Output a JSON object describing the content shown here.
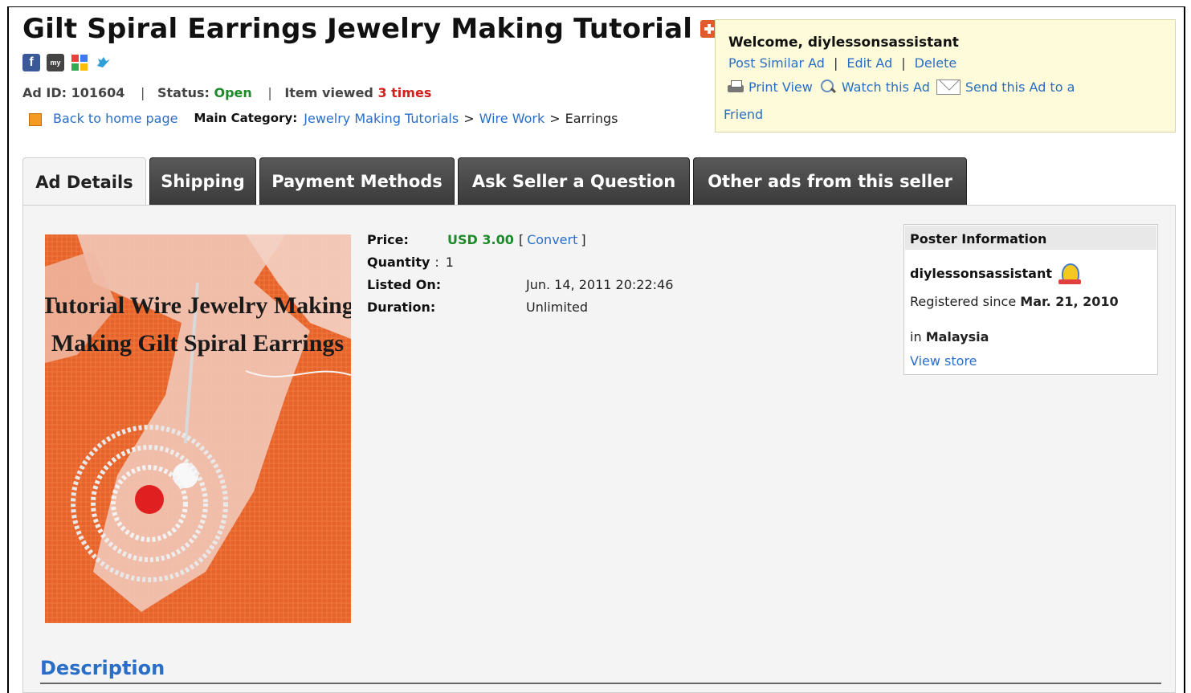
{
  "ad": {
    "title": "Gilt Spiral Earrings Jewelry Making Tutorial",
    "id_label": "Ad ID:",
    "id_value": "101604",
    "status_label": "Status:",
    "status_value": "Open",
    "views_label": "Item viewed",
    "views_value": "3 times"
  },
  "social": {
    "facebook": "f",
    "myspace": "my",
    "google": "g",
    "twitter": "t"
  },
  "nav": {
    "back_home": "Back to home page",
    "main_category_label": "Main Category:",
    "cat1": "Jewelry Making Tutorials",
    "cat2": "Wire Work",
    "cat3": "Earrings"
  },
  "account": {
    "welcome": "Welcome, diylessonsassistant",
    "post_similar": "Post Similar Ad",
    "edit": "Edit Ad",
    "delete": "Delete",
    "print_view": "Print View",
    "watch": "Watch this Ad",
    "send_friend": "Send this Ad to a",
    "friend": "Friend"
  },
  "tabs": [
    {
      "label": "Ad Details",
      "active": true
    },
    {
      "label": "Shipping",
      "active": false
    },
    {
      "label": "Payment Methods",
      "active": false
    },
    {
      "label": "Ask Seller a Question",
      "active": false
    },
    {
      "label": "Other ads from this seller",
      "active": false
    }
  ],
  "image": {
    "line1": "Tutorial Wire Jewelry Making",
    "line2": "Making Gilt Spiral Earrings"
  },
  "details": {
    "price_label": "Price:",
    "price_value": "USD 3.00",
    "convert": "Convert",
    "quantity_label": "Quantity",
    "quantity_value": "1",
    "listed_label": "Listed On:",
    "listed_value": "Jun. 14, 2011 20:22:46",
    "duration_label": "Duration:",
    "duration_value": "Unlimited"
  },
  "poster": {
    "header": "Poster Information",
    "name": "diylessonsassistant",
    "registered_prefix": "Registered since",
    "registered_date": "Mar. 21, 2010",
    "location_prefix": "in",
    "location": "Malaysia",
    "view_store": "View store"
  },
  "description": {
    "heading": "Description"
  },
  "colors": {
    "link": "#2a6ec7",
    "green": "#1e8a2a",
    "red": "#d2201e",
    "tab_dark": "#3a3a3a",
    "welcome_bg": "#fdfbd9"
  }
}
